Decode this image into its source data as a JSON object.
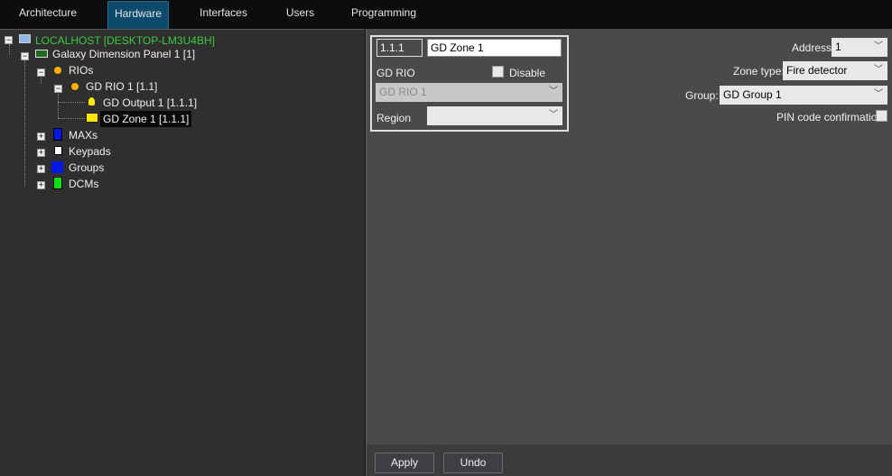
{
  "tabs": [
    {
      "label": "Architecture"
    },
    {
      "label": "Hardware",
      "active": true
    },
    {
      "label": "Interfaces"
    },
    {
      "label": "Users"
    },
    {
      "label": "Programming"
    }
  ],
  "tree": {
    "root": "LOCALHOST [DESKTOP-LM3U4BH]",
    "panel": "Galaxy Dimension Panel 1 [1]",
    "rios": "RIOs",
    "rio1": "GD RIO 1 [1.1]",
    "output1": "GD Output 1 [1.1.1]",
    "zone1": "GD Zone 1 [1.1.1]",
    "maxs": "MAXs",
    "keypads": "Keypads",
    "groups": "Groups",
    "dcms": "DCMs"
  },
  "form": {
    "id": "1.1.1",
    "name": "GD Zone 1",
    "rio_label": "GD RIO",
    "disable_label": "Disable",
    "rio_value": "GD RIO 1",
    "region_label": "Region",
    "region_value": "",
    "address_label": "Address:",
    "address_value": "1",
    "zone_type_label": "Zone type:",
    "zone_type_value": "Fire detector",
    "group_label": "Group:",
    "group_value": "GD Group 1",
    "pin_label": "PIN code confirmation"
  },
  "buttons": {
    "apply": "Apply",
    "undo": "Undo"
  },
  "colors": {
    "root_text": "#3cc83c",
    "active_tab": "#0e4a6c"
  }
}
